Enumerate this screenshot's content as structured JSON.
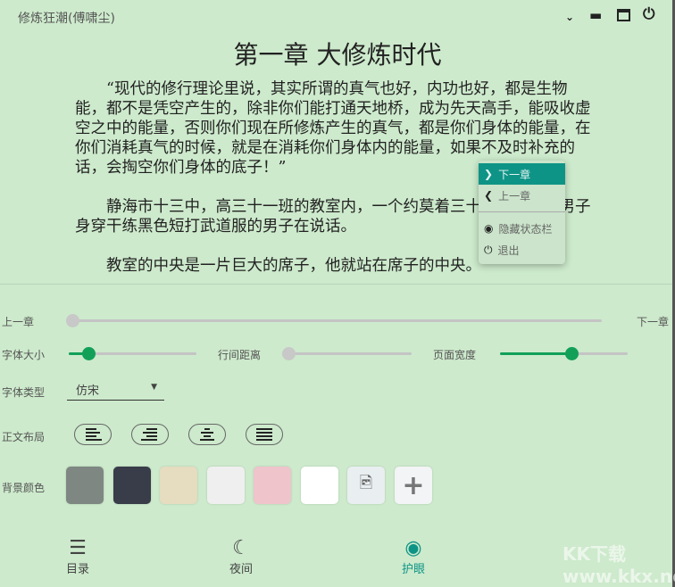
{
  "window": {
    "title": "修炼狂潮(傅啸尘)"
  },
  "chapter_title": "第一章 大修炼时代",
  "paragraphs": [
    "“现代的修行理论里说，其实所谓的真气也好，内功也好，都是生物能，都不是凭空产生的，除非你们能打通天地桥，成为先天高手，能吸收虚空之中的能量，否则你们现在所修炼产生的真气，都是你们身体的能量，在你们消耗真气的时候，就是在消耗你们身体内的能量，如果不及时补充的话，会掏空你们身体的底子！”",
    "静海市十三中，高三十一班的教室内，一个约莫着三十多岁的高大男子身穿干练黑色短打武道服的男子在说话。",
    "教室的中央是一片巨大的席子，他就站在席子的中央。"
  ],
  "context_menu": {
    "items": [
      "下一章",
      "上一章",
      "隐藏状态栏",
      "退出"
    ]
  },
  "settings": {
    "prev_chapter": "上一章",
    "next_chapter": "下一章",
    "chapter_progress": 0,
    "font_size_label": "字体大小",
    "font_size_value": 0.15,
    "line_spacing_label": "行间距离",
    "line_spacing_value": 0,
    "page_width_label": "页面宽度",
    "page_width_value": 0.55,
    "font_type_label": "字体类型",
    "font_type_value": "仿宋",
    "layout_label": "正文布局",
    "bg_label": "背景颜色",
    "bg_colors": [
      "#7f8782",
      "#393c49",
      "#e6dcc0",
      "#efefef",
      "#efc4cb",
      "#ffffff"
    ],
    "accent": "#12a058"
  },
  "bottom_nav": [
    {
      "label": "目录"
    },
    {
      "label": "夜间"
    },
    {
      "label": "护眼"
    }
  ],
  "watermark": "KK下载 www.kkx.net"
}
